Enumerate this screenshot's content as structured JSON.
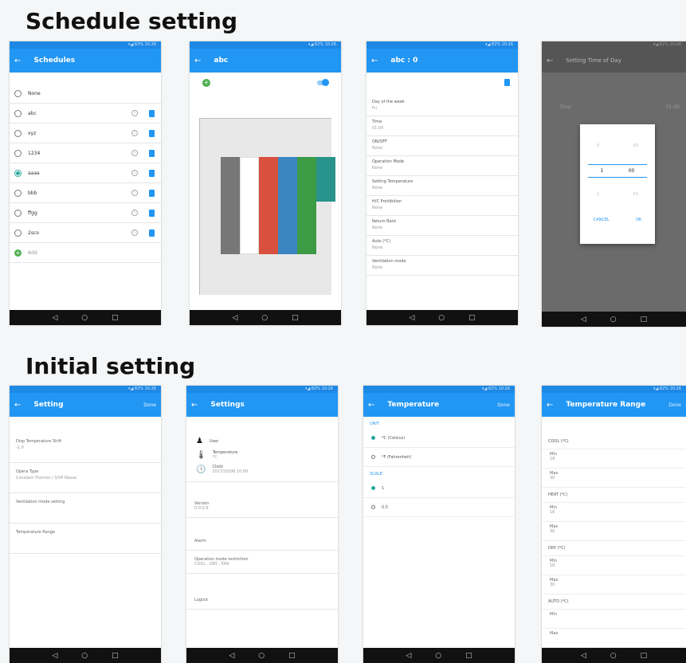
{
  "sections": {
    "schedule_title": "Schedule setting",
    "initial_title": "Initial setting"
  },
  "schedules_screen": {
    "title": "Schedules",
    "items": [
      {
        "name": "None",
        "selected": false,
        "editable": false
      },
      {
        "name": "abc",
        "selected": false,
        "editable": true
      },
      {
        "name": "xyz",
        "selected": false,
        "editable": true
      },
      {
        "name": "1234",
        "selected": false,
        "editable": true
      },
      {
        "name": "aaaa",
        "selected": true,
        "editable": true
      },
      {
        "name": "bbb",
        "selected": false,
        "editable": true
      },
      {
        "name": "ffgg",
        "selected": false,
        "editable": true
      },
      {
        "name": "2sco",
        "selected": false,
        "editable": true
      }
    ],
    "add_label": "Add"
  },
  "abc_screen": {
    "title": "abc",
    "bars": [
      "#777777",
      "#ffffff",
      "#d9503f",
      "#3a86c2",
      "#3d9b45",
      "#28938b"
    ]
  },
  "abc_detail_screen": {
    "title": "abc : 0",
    "fields": [
      {
        "label": "Day of the week",
        "value": "Fri"
      },
      {
        "label": "Time",
        "value": "01:00"
      },
      {
        "label": "ON/OFF",
        "value": "None"
      },
      {
        "label": "Operation Mode",
        "value": "None"
      },
      {
        "label": "Setting Temperature",
        "value": "None"
      },
      {
        "label": "H/C Prohibition",
        "value": "None"
      },
      {
        "label": "Return Back",
        "value": "None"
      },
      {
        "label": "Auto (*C)",
        "value": "None"
      },
      {
        "label": "Ventilation mode",
        "value": "None"
      }
    ]
  },
  "time_dialog_screen": {
    "title": "Setting Time of Day",
    "label": "Time",
    "value": "01:00",
    "hour": "1",
    "minute": "00",
    "hour_prev": "0",
    "minute_prev": "59",
    "hour_next": "2",
    "minute_next": "01",
    "cancel": "CANCEL",
    "ok": "OK"
  },
  "setting_screen": {
    "title": "Setting",
    "action": "Done",
    "items": [
      {
        "label": "Disp Temperature Shift",
        "value": "-1.0"
      },
      {
        "label": "Opera Type",
        "value": "Constant Thermo / 3/VP Nasse"
      },
      {
        "label": "Ventilation mode setting",
        "value": ""
      },
      {
        "label": "Temperature Range",
        "value": ""
      }
    ]
  },
  "settings_screen": {
    "title": "Settings",
    "entries": [
      {
        "label": "User",
        "value": ""
      },
      {
        "label": "Temperature",
        "value": "*C"
      },
      {
        "label": "Clock",
        "value": "2017/10/08 10:00"
      }
    ],
    "version_label": "Version",
    "version_value": "0.0.0.9",
    "alarm_label": "Alarm",
    "restriction_label": "Operation mode restriction",
    "restriction_value": "COOL , DRY , FAN",
    "logout_label": "Logout"
  },
  "temperature_screen": {
    "title": "Temperature",
    "action": "Done",
    "unit_label": "UNIT",
    "units": [
      {
        "label": "*C (Celsius)",
        "selected": true
      },
      {
        "label": "*F (Fahrenheit)",
        "selected": false
      }
    ],
    "scale_label": "SCALE",
    "scales": [
      {
        "label": "1",
        "selected": true
      },
      {
        "label": "0.5",
        "selected": false
      }
    ]
  },
  "range_screen": {
    "title": "Temperature Range",
    "action": "Done",
    "groups": [
      {
        "name": "COOL (*C)",
        "min": "18",
        "max": "30"
      },
      {
        "name": "HEAT (*C)",
        "min": "16",
        "max": "30"
      },
      {
        "name": "DRY (*C)",
        "min": "18",
        "max": "30"
      },
      {
        "name": "AUTO (*C)",
        "min": "",
        "max": ""
      }
    ],
    "min_label": "Min",
    "max_label": "Max"
  },
  "nav": {
    "back": "◁",
    "home": "○",
    "recent": "□"
  }
}
